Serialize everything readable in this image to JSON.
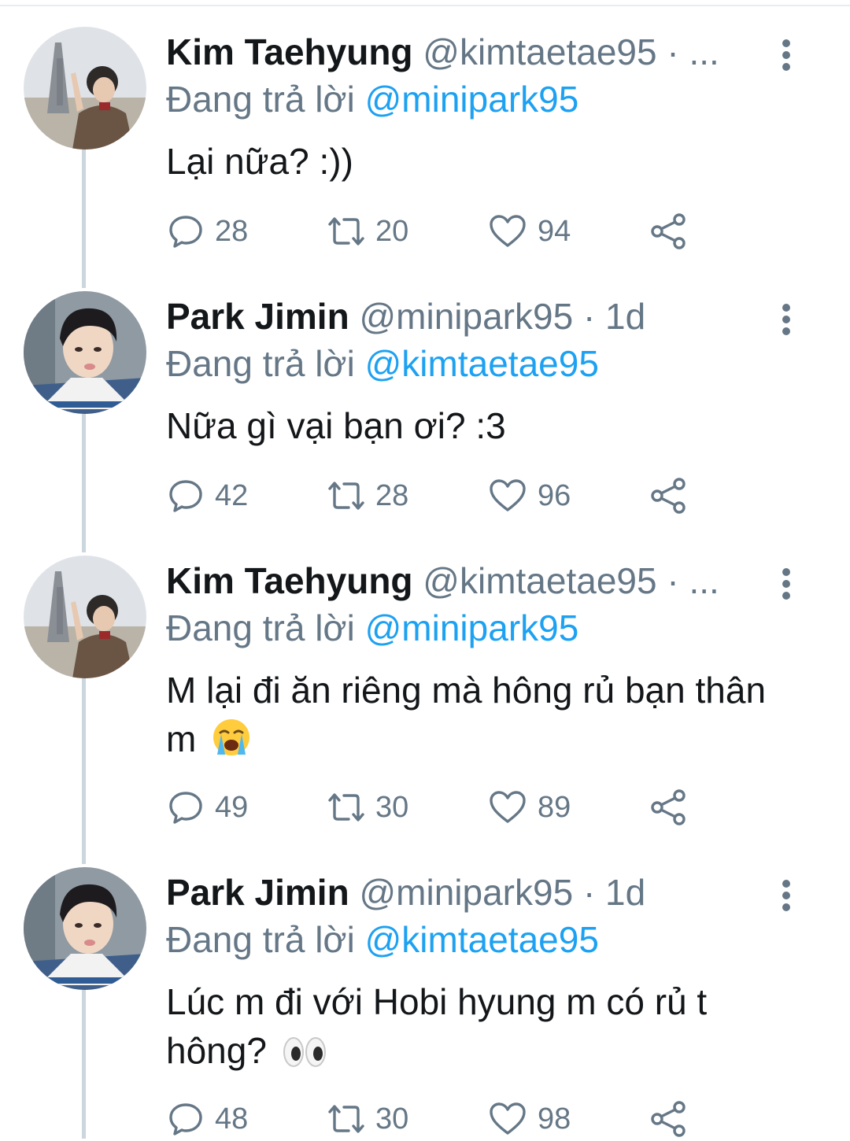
{
  "reply_prefix": "Đang trả lời",
  "colors": {
    "link_blue": "#1da1f2",
    "secondary_text": "#657786",
    "thread_line": "#ccd6dd"
  },
  "tweets": [
    {
      "name": "Kim Taehyung",
      "handle": "@kimtaetae95",
      "separator": "·",
      "time": "...",
      "reply_to": "@minipark95",
      "text": "Lại nữa? :))",
      "emoji": "",
      "avatar_icon": "avatar-taehyung",
      "replies": "28",
      "retweets": "20",
      "likes": "94"
    },
    {
      "name": "Park Jimin",
      "handle": "@minipark95",
      "separator": "·",
      "time": "1d",
      "reply_to": "@kimtaetae95",
      "text": "Nữa gì vại bạn ơi? :3",
      "emoji": "",
      "avatar_icon": "avatar-jimin",
      "replies": "42",
      "retweets": "28",
      "likes": "96"
    },
    {
      "name": "Kim Taehyung",
      "handle": "@kimtaetae95",
      "separator": "·",
      "time": "...",
      "reply_to": "@minipark95",
      "text": "M lại đi ăn riêng mà hông rủ bạn thân m",
      "emoji": "loudly-crying-face",
      "avatar_icon": "avatar-taehyung",
      "replies": "49",
      "retweets": "30",
      "likes": "89"
    },
    {
      "name": "Park Jimin",
      "handle": "@minipark95",
      "separator": "·",
      "time": "1d",
      "reply_to": "@kimtaetae95",
      "text": "Lúc m đi với Hobi hyung m có rủ t hông?",
      "emoji": "eyes",
      "avatar_icon": "avatar-jimin",
      "replies": "48",
      "retweets": "30",
      "likes": "98"
    }
  ]
}
